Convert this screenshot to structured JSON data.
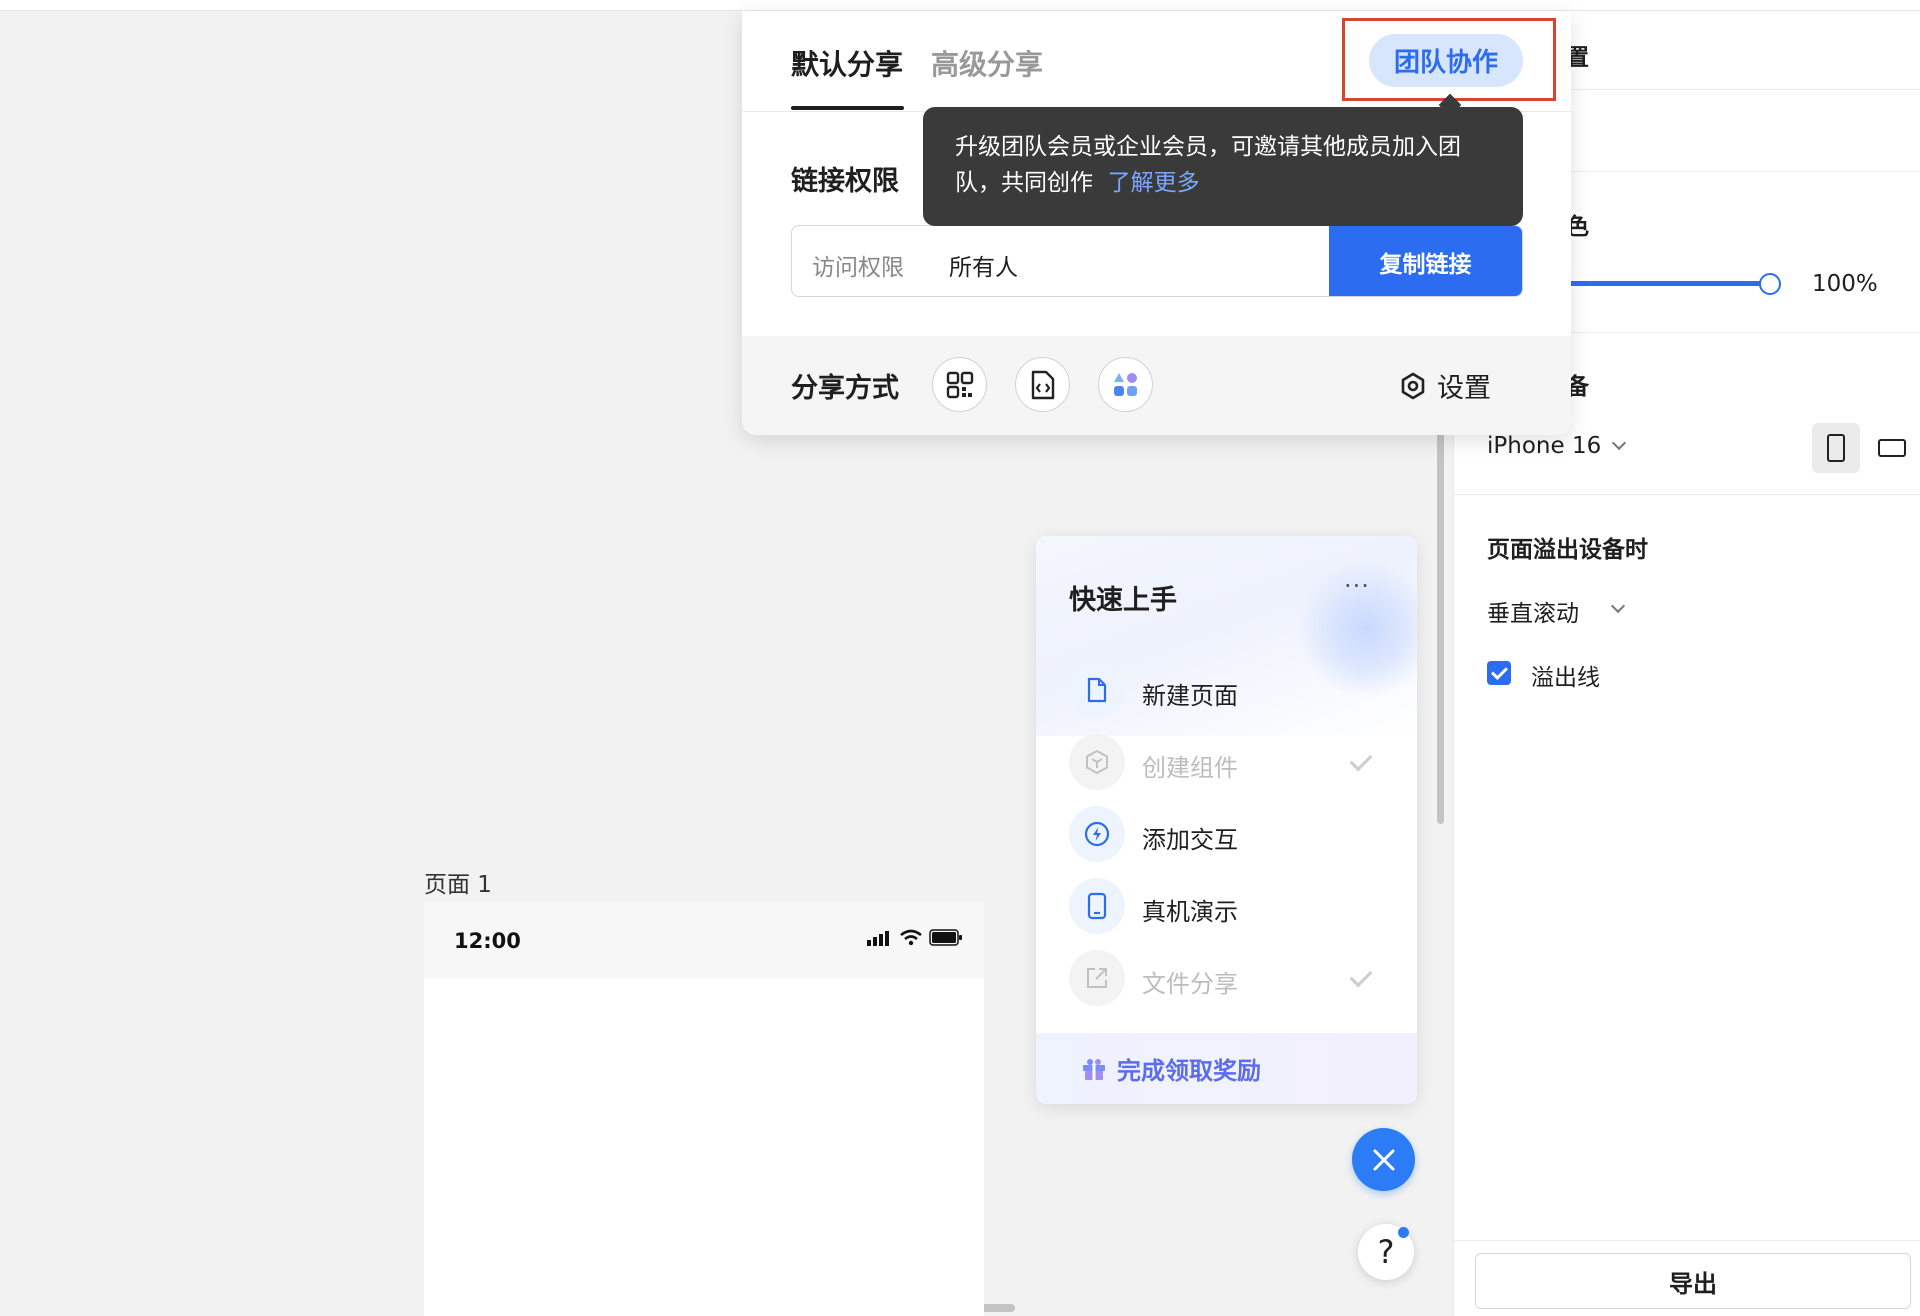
{
  "share_dialog": {
    "tabs": [
      "默认分享",
      "高级分享"
    ],
    "team_button": "团队协作",
    "link_permission_label": "链接权限",
    "access_label": "访问权限",
    "access_value": "所有人",
    "copy_button": "复制链接",
    "share_method_label": "分享方式",
    "share_methods": [
      "qr-code-icon",
      "embed-code-icon",
      "apps-icon"
    ],
    "settings_label": "设置"
  },
  "tooltip": {
    "text": "升级团队会员或企业会员，可邀请其他成员加入团队，共同创作",
    "link": "了解更多"
  },
  "right_panel": {
    "fragment_1": "置",
    "fragment_2": "色",
    "fragment_3": "备",
    "opacity_value": "100%",
    "opacity_level": 1.0,
    "device": "iPhone 16",
    "overflow_title": "页面溢出设备时",
    "overflow_mode": "垂直滚动",
    "overflow_line_label": "溢出线",
    "overflow_line_checked": true,
    "export_button": "导出"
  },
  "canvas": {
    "page_label": "页面 1",
    "phone_time": "12:00"
  },
  "quick_start": {
    "title": "快速上手",
    "more": "···",
    "items": [
      {
        "label": "新建页面",
        "icon": "document-icon",
        "done": false
      },
      {
        "label": "创建组件",
        "icon": "cube-icon",
        "done": true
      },
      {
        "label": "添加交互",
        "icon": "lightning-icon",
        "done": false
      },
      {
        "label": "真机演示",
        "icon": "phone-icon",
        "done": false
      },
      {
        "label": "文件分享",
        "icon": "share-icon",
        "done": true
      }
    ],
    "reward": "完成领取奖励"
  },
  "colors": {
    "primary": "#2b6cf0",
    "highlight": "#d6452e",
    "tooltip_bg": "#3a3a3a"
  }
}
